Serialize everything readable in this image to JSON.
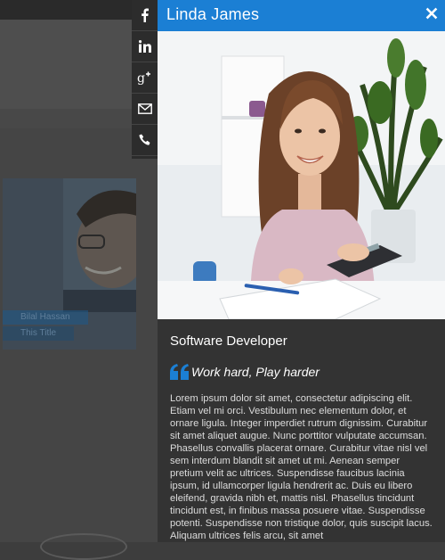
{
  "background": {
    "card_name": "Bilal Hassan",
    "card_role": "This Title"
  },
  "social": [
    {
      "name": "facebook-icon"
    },
    {
      "name": "linkedin-icon"
    },
    {
      "name": "google-plus-icon"
    },
    {
      "name": "mail-icon"
    },
    {
      "name": "phone-icon"
    }
  ],
  "panel": {
    "title": "Linda James",
    "job_title": "Software Developer",
    "quote": "Work hard, Play harder",
    "bio": "Lorem ipsum dolor sit amet, consectetur adipiscing elit. Etiam vel mi orci. Vestibulum nec elementum dolor, et ornare ligula. Integer imperdiet rutrum dignissim. Curabitur sit amet aliquet augue. Nunc porttitor vulputate accumsan. Phasellus convallis placerat ornare. Curabitur vitae nisl vel sem interdum blandit sit amet ut mi. Aenean semper pretium velit ac ultrices. Suspendisse faucibus lacinia ipsum, id ullamcorper ligula hendrerit ac. Duis eu libero eleifend, gravida nibh et, mattis nisl. Phasellus tincidunt tincidunt est, in finibus massa posuere vitae. Suspendisse potenti. Suspendisse non tristique dolor, quis suscipit lacus. Aliquam ultrices felis arcu, sit amet"
  },
  "colors": {
    "header": "#1b7fd4",
    "panel_bg": "#333333",
    "quote_icon": "#1b7fd4"
  }
}
